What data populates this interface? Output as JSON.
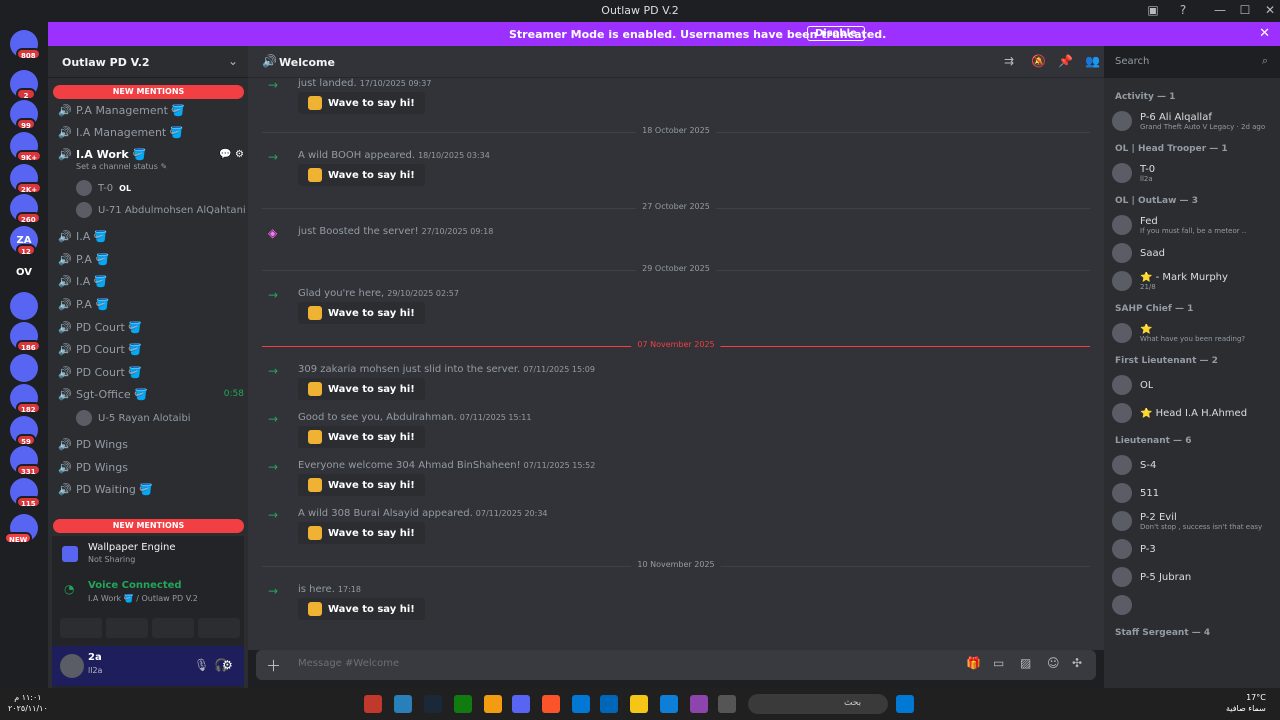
{
  "window": {
    "title": "Outlaw PD V.2"
  },
  "streamer": {
    "message": "Streamer Mode is enabled. Usernames have been truncated.",
    "disable_label": "Disable"
  },
  "guilds": [
    {
      "label": "",
      "badge": "808"
    },
    {
      "label": "",
      "badge": "2"
    },
    {
      "label": "",
      "badge": "99"
    },
    {
      "label": "",
      "badge": "9K+"
    },
    {
      "label": "",
      "badge": "2K+"
    },
    {
      "label": "",
      "badge": "260"
    },
    {
      "label": "ZA",
      "badge": "12"
    },
    {
      "label": "OV",
      "badge": ""
    },
    {
      "label": "",
      "badge": ""
    },
    {
      "label": "",
      "badge": "186"
    },
    {
      "label": "",
      "badge": ""
    },
    {
      "label": "",
      "badge": "182"
    },
    {
      "label": "",
      "badge": "59"
    },
    {
      "label": "",
      "badge": "331"
    },
    {
      "label": "",
      "badge": "115"
    },
    {
      "label": "",
      "badge": "NEW"
    }
  ],
  "server": {
    "name": "Outlaw PD V.2",
    "new_mentions": "NEW MENTIONS",
    "channels": [
      {
        "name": "P.A Management 🪣",
        "type": "voice"
      },
      {
        "name": "I.A Management 🪣",
        "type": "voice"
      },
      {
        "name": "I.A Work 🪣",
        "type": "voice",
        "active": true,
        "status": "Set a channel status ✎"
      },
      {
        "name": "I.A 🪣",
        "type": "voice"
      },
      {
        "name": "P.A 🪣",
        "type": "voice"
      },
      {
        "name": "I.A 🪣",
        "type": "voice"
      },
      {
        "name": "P.A 🪣",
        "type": "voice"
      },
      {
        "name": "PD Court 🪣",
        "type": "voice"
      },
      {
        "name": "PD Court 🪣",
        "type": "voice"
      },
      {
        "name": "PD Court 🪣",
        "type": "voice"
      },
      {
        "name": "Sgt-Office 🪣",
        "type": "voice",
        "timer": "0:58"
      },
      {
        "name": "PD Wings",
        "type": "voice"
      },
      {
        "name": "PD Wings",
        "type": "voice"
      },
      {
        "name": "PD Waiting 🪣",
        "type": "voice"
      }
    ],
    "voice_users": [
      {
        "name": "T-0",
        "tag": "OL"
      },
      {
        "name": "U-71 Abdulmohsen AlQahtani",
        "tag": ""
      },
      {
        "name": "U-5 Rayan Alotaibi",
        "tag": ""
      }
    ]
  },
  "activity": {
    "app": "Wallpaper Engine",
    "status": "Not Sharing"
  },
  "voice": {
    "label": "Voice Connected",
    "channel": "I.A Work 🪣 / Outlaw PD V.2"
  },
  "user": {
    "name": "2a",
    "sub": "ll2a"
  },
  "chat": {
    "channel": "Welcome",
    "placeholder": "Message #Welcome",
    "wave_label": "Wave to say hi!",
    "messages": [
      {
        "kind": "text",
        "text": "just landed.",
        "ts": "17/10/2025 09:37"
      },
      {
        "kind": "divider",
        "text": "18 October 2025"
      },
      {
        "kind": "text",
        "text": "A wild BOOH appeared.",
        "ts": "18/10/2025 03:34"
      },
      {
        "kind": "divider",
        "text": "27 October 2025"
      },
      {
        "kind": "boost",
        "text": "just Boosted the server!",
        "ts": "27/10/2025 09:18"
      },
      {
        "kind": "divider",
        "text": "29 October 2025"
      },
      {
        "kind": "text",
        "text": "Glad you're here,",
        "ts": "29/10/2025 02:57"
      },
      {
        "kind": "newdiv",
        "text": "07 November 2025"
      },
      {
        "kind": "text",
        "text": "309 zakaria mohsen just slid into the server.",
        "ts": "07/11/2025 15:09"
      },
      {
        "kind": "text",
        "text": "Good to see you, Abdulrahman.",
        "ts": "07/11/2025 15:11"
      },
      {
        "kind": "text",
        "text": "Everyone welcome 304 Ahmad BinShaheen!",
        "ts": "07/11/2025 15:52"
      },
      {
        "kind": "text",
        "text": "A wild 308 Burai Alsayid appeared.",
        "ts": "07/11/2025 20:34"
      },
      {
        "kind": "divider",
        "text": "10 November 2025"
      },
      {
        "kind": "text",
        "text": "is here.",
        "ts": "17:18"
      }
    ]
  },
  "members": {
    "search_placeholder": "Search",
    "groups": [
      {
        "header": "Activity — 1",
        "items": [
          {
            "name": "P-6 Ali Alqallaf",
            "sub": "Grand Theft Auto V Legacy · 2d ago"
          }
        ]
      },
      {
        "header": "OL | Head Trooper — 1",
        "items": [
          {
            "name": "T-0",
            "sub": "ll2a"
          }
        ]
      },
      {
        "header": "OL | OutLaw — 3",
        "items": [
          {
            "name": "Fed",
            "sub": "If you must fall, be a meteor .."
          },
          {
            "name": "Saad",
            "sub": ""
          },
          {
            "name": "⭐ - Mark Murphy",
            "sub": "21/8"
          }
        ]
      },
      {
        "header": "SAHP Chief — 1",
        "items": [
          {
            "name": "⭐",
            "sub": "What have you been reading?"
          }
        ]
      },
      {
        "header": "First Lieutenant — 2",
        "items": [
          {
            "name": "OL",
            "sub": ""
          },
          {
            "name": "⭐ Head I.A H.Ahmed",
            "sub": ""
          }
        ]
      },
      {
        "header": "Lieutenant — 6",
        "items": [
          {
            "name": "S-4",
            "sub": ""
          },
          {
            "name": "511",
            "sub": ""
          },
          {
            "name": "P-2 Evil",
            "sub": "Don't stop , success isn't that easy"
          },
          {
            "name": "P-3",
            "sub": ""
          },
          {
            "name": "P-5 Jubran",
            "sub": ""
          },
          {
            "name": "",
            "sub": ""
          }
        ]
      },
      {
        "header": "Staff Sergeant — 4",
        "items": []
      }
    ]
  },
  "taskbar": {
    "time": "١١:٠١ م",
    "date": "٢٠٢٥/١١/١٠",
    "weather": "17°C",
    "weather_sub": "سماء صافية",
    "search": "بحث"
  }
}
